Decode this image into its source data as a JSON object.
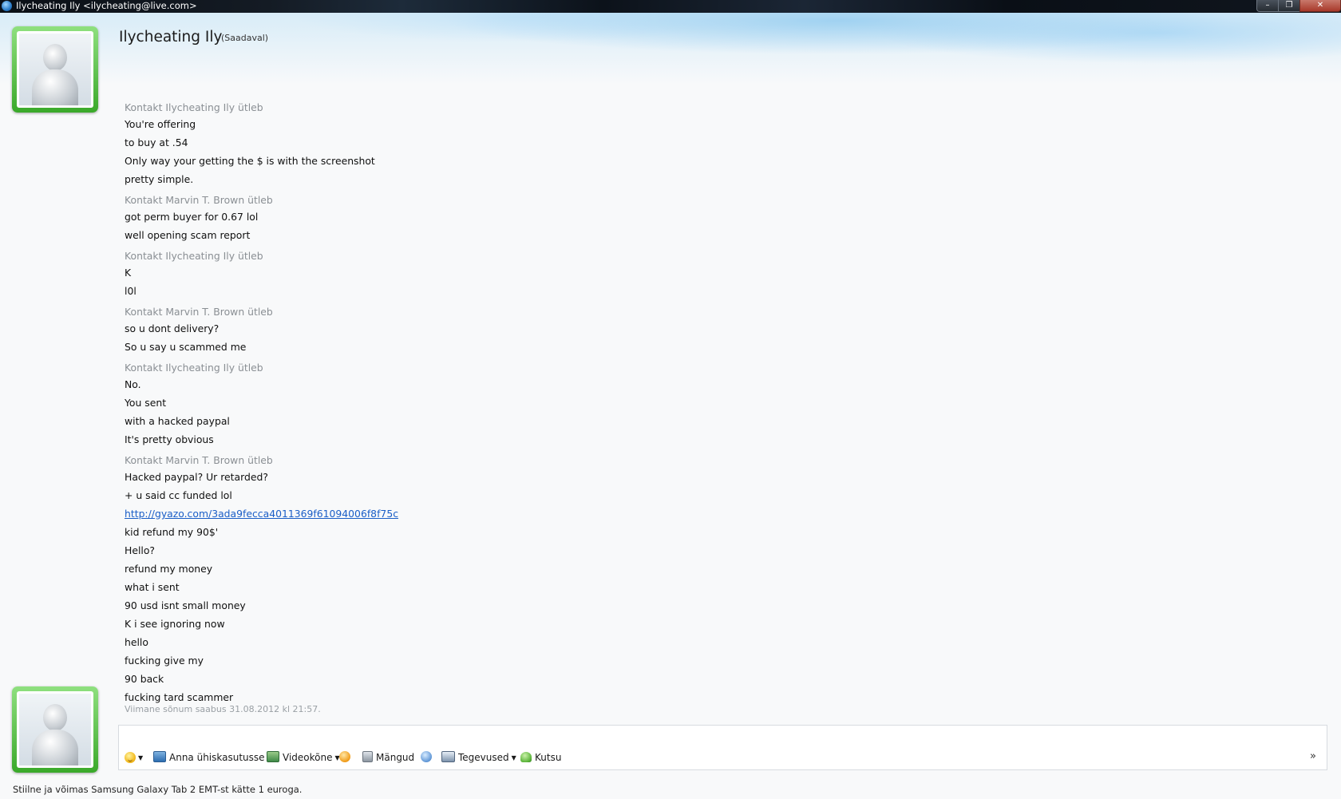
{
  "window": {
    "title": "Ilycheating Ily <ilycheating@live.com>",
    "minimize_glyph": "–",
    "maximize_glyph": "❐",
    "close_glyph": "✕"
  },
  "contact": {
    "name": "Ilycheating Ily",
    "status": "(Saadaval)"
  },
  "conversation": [
    {
      "sender": "Kontakt Ilycheating Ily ütleb",
      "messages": [
        "You're offering",
        "to buy at .54",
        "Only way your getting the $ is with the screenshot",
        "pretty simple."
      ]
    },
    {
      "sender": "Kontakt Marvin T. Brown ütleb",
      "messages": [
        "got perm buyer for 0.67 lol",
        "well opening scam report"
      ]
    },
    {
      "sender": "Kontakt Ilycheating Ily ütleb",
      "messages": [
        "K",
        "l0l"
      ]
    },
    {
      "sender": "Kontakt Marvin T. Brown ütleb",
      "messages": [
        "so u dont delivery?",
        "So u say u scammed me"
      ]
    },
    {
      "sender": "Kontakt Ilycheating Ily ütleb",
      "messages": [
        "No.",
        "You sent",
        "with a hacked paypal",
        "It's pretty obvious"
      ]
    },
    {
      "sender": "Kontakt Marvin T. Brown ütleb",
      "messages": [
        "Hacked paypal? Ur retarded?",
        "+ u said cc funded lol",
        "http://gyazo.com/3ada9fecca4011369f61094006f8f75c",
        "kid refund my 90$'",
        "Hello?",
        "refund my money",
        "what i sent",
        "90 usd isnt small money",
        "K i see ignoring now",
        "hello",
        "fucking give my",
        "90 back",
        "fucking tard scammer"
      ]
    }
  ],
  "last_message_info": "Viimane sõnum saabus 31.08.2012 kl 21:57.",
  "toolbar": {
    "emoticon_icon": "smiley-icon",
    "share_label": "Anna ühiskasutusse",
    "video_label": "Videokõne",
    "games_label": "Mängud",
    "activities_label": "Tegevused",
    "invite_label": "Kutsu",
    "more_glyph": "»"
  },
  "ad_text": "Stiilne ja võimas Samsung Galaxy Tab 2 EMT-st kätte 1 euroga.",
  "colors": {
    "avatar_frame": "#3aa92a",
    "link": "#1a5ec7",
    "sender_gray": "#8a8f94"
  }
}
